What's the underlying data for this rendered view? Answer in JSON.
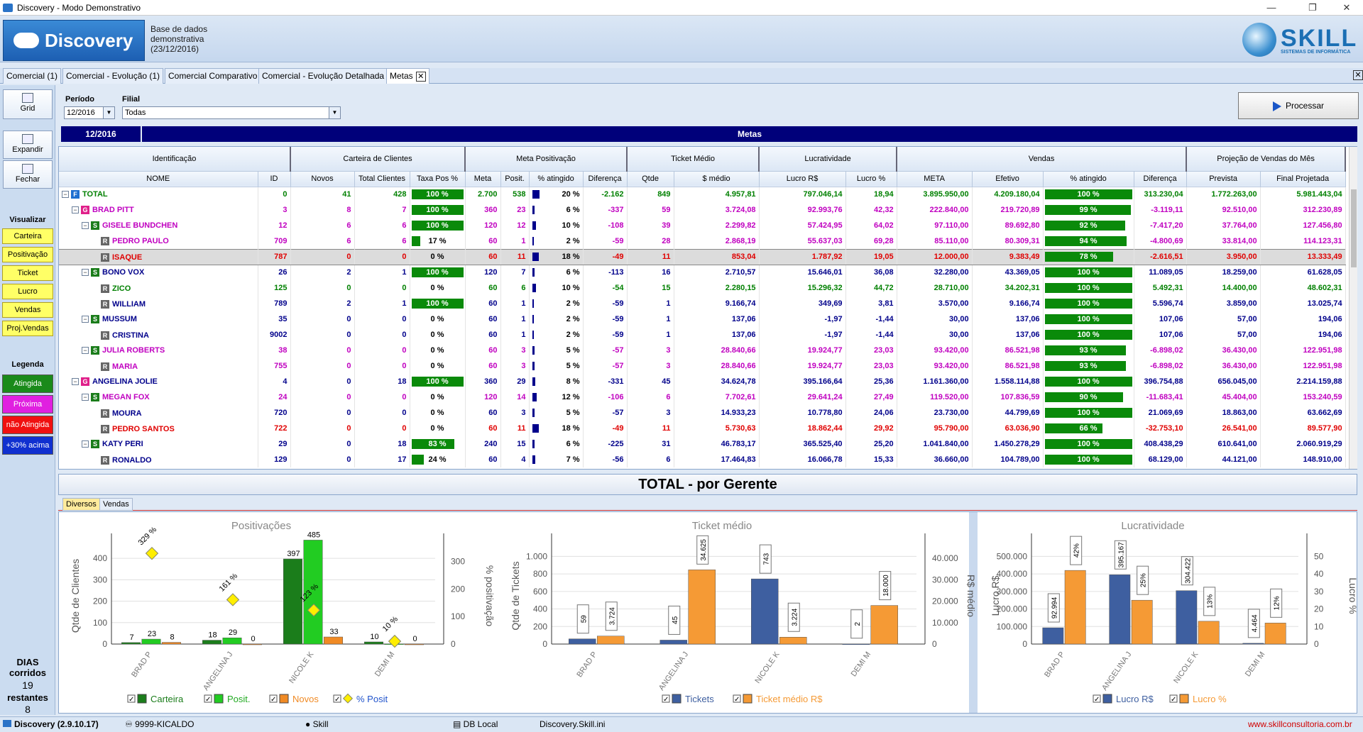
{
  "window": {
    "title": "Discovery - Modo Demonstrativo"
  },
  "header": {
    "logo": "Discovery",
    "db_line1": "Base de dados",
    "db_line2": "demonstrativa",
    "db_line3": "(23/12/2016)",
    "brand": "SKILL",
    "brand_sub": "SISTEMAS DE INFORMÁTICA"
  },
  "tabs": [
    "Comercial (1)",
    "Comercial - Evolução (1)",
    "Comercial Comparativo",
    "Comercial - Evolução Detalhada",
    "Metas"
  ],
  "sidebar": {
    "grid": "Grid",
    "expandir": "Expandir",
    "fechar": "Fechar",
    "visualizar": "Visualizar",
    "views": [
      "Carteira",
      "Positivação",
      "Ticket",
      "Lucro",
      "Vendas",
      "Proj.Vendas"
    ],
    "legenda": "Legenda",
    "legend": [
      {
        "label": "Atingida",
        "color": "#1a8a1a"
      },
      {
        "label": "Próxima",
        "color": "#e020e0"
      },
      {
        "label": "não Atingida",
        "color": "#f01010"
      },
      {
        "label": "+30% acima",
        "color": "#1030d0"
      }
    ],
    "dias_corridos": "DIAS corridos",
    "dias_corridos_val": "19",
    "restantes": "restantes",
    "restantes_val": "8"
  },
  "filters": {
    "periodo_label": "Período",
    "periodo": "12/2016",
    "filial_label": "Filial",
    "filial": "Todas",
    "processar": "Processar"
  },
  "band": {
    "period": "12/2016",
    "title": "Metas"
  },
  "grid": {
    "groups": [
      "Identificação",
      "Carteira de Clientes",
      "Meta Positivação",
      "Ticket Médio",
      "Lucratividade",
      "Vendas",
      "Projeção de Vendas do Mês"
    ],
    "columns": [
      "NOME",
      "ID",
      "Novos",
      "Total Clientes",
      "Taxa Pos %",
      "Meta",
      "Posit.",
      "% atingido",
      "Diferença",
      "Qtde",
      "$ médio",
      "Lucro R$",
      "Lucro %",
      "META",
      "Efetivo",
      "% atingido",
      "Diferença",
      "Prevista",
      "Final Projetada"
    ],
    "rows": [
      {
        "lvl": "F",
        "ind": 0,
        "exp": true,
        "name": "TOTAL",
        "col": "green",
        "id": "0",
        "novos": "41",
        "tc": "428",
        "taxa": "100 %",
        "tp": 100,
        "meta": "2.700",
        "posit": "538",
        "pct": "20 %",
        "pp": 20,
        "dif": "-2.162",
        "qtde": "849",
        "med": "4.957,81",
        "lr": "797.046,14",
        "lp": "18,94",
        "vm": "3.895.950,00",
        "ef": "4.209.180,04",
        "va": "100 %",
        "vp": 100,
        "vd": "313.230,04",
        "prev": "1.772.263,00",
        "fin": "5.981.443,04"
      },
      {
        "lvl": "G",
        "ind": 1,
        "exp": true,
        "name": "BRAD PITT",
        "col": "mag",
        "id": "3",
        "novos": "8",
        "tc": "7",
        "taxa": "100 %",
        "tp": 100,
        "meta": "360",
        "posit": "23",
        "pct": "6 %",
        "pp": 6,
        "dif": "-337",
        "qtde": "59",
        "med": "3.724,08",
        "lr": "92.993,76",
        "lp": "42,32",
        "vm": "222.840,00",
        "ef": "219.720,89",
        "va": "99 %",
        "vp": 99,
        "vd": "-3.119,11",
        "prev": "92.510,00",
        "fin": "312.230,89"
      },
      {
        "lvl": "S",
        "ind": 2,
        "exp": true,
        "name": "GISELE BUNDCHEN",
        "col": "mag",
        "id": "12",
        "novos": "6",
        "tc": "6",
        "taxa": "100 %",
        "tp": 100,
        "meta": "120",
        "posit": "12",
        "pct": "10 %",
        "pp": 10,
        "dif": "-108",
        "qtde": "39",
        "med": "2.299,82",
        "lr": "57.424,95",
        "lp": "64,02",
        "vm": "97.110,00",
        "ef": "89.692,80",
        "va": "92 %",
        "vp": 92,
        "vd": "-7.417,20",
        "prev": "37.764,00",
        "fin": "127.456,80"
      },
      {
        "lvl": "R",
        "ind": 3,
        "exp": false,
        "name": "PEDRO PAULO",
        "col": "mag",
        "id": "709",
        "novos": "6",
        "tc": "6",
        "taxa": "17 %",
        "tp": 17,
        "meta": "60",
        "posit": "1",
        "pct": "2 %",
        "pp": 2,
        "dif": "-59",
        "qtde": "28",
        "med": "2.868,19",
        "lr": "55.637,03",
        "lp": "69,28",
        "vm": "85.110,00",
        "ef": "80.309,31",
        "va": "94 %",
        "vp": 94,
        "vd": "-4.800,69",
        "prev": "33.814,00",
        "fin": "114.123,31"
      },
      {
        "lvl": "R",
        "ind": 3,
        "exp": false,
        "name": "ISAQUE",
        "col": "red",
        "hl": true,
        "id": "787",
        "novos": "0",
        "tc": "0",
        "taxa": "0 %",
        "tp": 0,
        "meta": "60",
        "posit": "11",
        "pct": "18 %",
        "pp": 18,
        "dif": "-49",
        "qtde": "11",
        "med": "853,04",
        "lr": "1.787,92",
        "lp": "19,05",
        "vm": "12.000,00",
        "ef": "9.383,49",
        "va": "78 %",
        "vp": 78,
        "vd": "-2.616,51",
        "prev": "3.950,00",
        "fin": "13.333,49"
      },
      {
        "lvl": "S",
        "ind": 2,
        "exp": true,
        "name": "BONO VOX",
        "col": "blue",
        "id": "26",
        "novos": "2",
        "tc": "1",
        "taxa": "100 %",
        "tp": 100,
        "meta": "120",
        "posit": "7",
        "pct": "6 %",
        "pp": 6,
        "dif": "-113",
        "qtde": "16",
        "med": "2.710,57",
        "lr": "15.646,01",
        "lp": "36,08",
        "vm": "32.280,00",
        "ef": "43.369,05",
        "va": "100 %",
        "vp": 100,
        "vd": "11.089,05",
        "prev": "18.259,00",
        "fin": "61.628,05"
      },
      {
        "lvl": "R",
        "ind": 3,
        "exp": false,
        "name": "ZICO",
        "col": "green",
        "id": "125",
        "novos": "0",
        "tc": "0",
        "taxa": "0 %",
        "tp": 0,
        "meta": "60",
        "posit": "6",
        "pct": "10 %",
        "pp": 10,
        "dif": "-54",
        "qtde": "15",
        "med": "2.280,15",
        "lr": "15.296,32",
        "lp": "44,72",
        "vm": "28.710,00",
        "ef": "34.202,31",
        "va": "100 %",
        "vp": 100,
        "vd": "5.492,31",
        "prev": "14.400,00",
        "fin": "48.602,31"
      },
      {
        "lvl": "R",
        "ind": 3,
        "exp": false,
        "name": "WILLIAM",
        "col": "blue",
        "id": "789",
        "novos": "2",
        "tc": "1",
        "taxa": "100 %",
        "tp": 100,
        "meta": "60",
        "posit": "1",
        "pct": "2 %",
        "pp": 2,
        "dif": "-59",
        "qtde": "1",
        "med": "9.166,74",
        "lr": "349,69",
        "lp": "3,81",
        "vm": "3.570,00",
        "ef": "9.166,74",
        "va": "100 %",
        "vp": 100,
        "vd": "5.596,74",
        "prev": "3.859,00",
        "fin": "13.025,74"
      },
      {
        "lvl": "S",
        "ind": 2,
        "exp": true,
        "name": "MUSSUM",
        "col": "blue",
        "id": "35",
        "novos": "0",
        "tc": "0",
        "taxa": "0 %",
        "tp": 0,
        "meta": "60",
        "posit": "1",
        "pct": "2 %",
        "pp": 2,
        "dif": "-59",
        "qtde": "1",
        "med": "137,06",
        "lr": "-1,97",
        "lp": "-1,44",
        "vm": "30,00",
        "ef": "137,06",
        "va": "100 %",
        "vp": 100,
        "vd": "107,06",
        "prev": "57,00",
        "fin": "194,06"
      },
      {
        "lvl": "R",
        "ind": 3,
        "exp": false,
        "name": "CRISTINA",
        "col": "blue",
        "id": "9002",
        "novos": "0",
        "tc": "0",
        "taxa": "0 %",
        "tp": 0,
        "meta": "60",
        "posit": "1",
        "pct": "2 %",
        "pp": 2,
        "dif": "-59",
        "qtde": "1",
        "med": "137,06",
        "lr": "-1,97",
        "lp": "-1,44",
        "vm": "30,00",
        "ef": "137,06",
        "va": "100 %",
        "vp": 100,
        "vd": "107,06",
        "prev": "57,00",
        "fin": "194,06"
      },
      {
        "lvl": "S",
        "ind": 2,
        "exp": true,
        "name": "JULIA ROBERTS",
        "col": "mag",
        "id": "38",
        "novos": "0",
        "tc": "0",
        "taxa": "0 %",
        "tp": 0,
        "meta": "60",
        "posit": "3",
        "pct": "5 %",
        "pp": 5,
        "dif": "-57",
        "qtde": "3",
        "med": "28.840,66",
        "lr": "19.924,77",
        "lp": "23,03",
        "vm": "93.420,00",
        "ef": "86.521,98",
        "va": "93 %",
        "vp": 93,
        "vd": "-6.898,02",
        "prev": "36.430,00",
        "fin": "122.951,98"
      },
      {
        "lvl": "R",
        "ind": 3,
        "exp": false,
        "name": "MARIA",
        "col": "mag",
        "id": "755",
        "novos": "0",
        "tc": "0",
        "taxa": "0 %",
        "tp": 0,
        "meta": "60",
        "posit": "3",
        "pct": "5 %",
        "pp": 5,
        "dif": "-57",
        "qtde": "3",
        "med": "28.840,66",
        "lr": "19.924,77",
        "lp": "23,03",
        "vm": "93.420,00",
        "ef": "86.521,98",
        "va": "93 %",
        "vp": 93,
        "vd": "-6.898,02",
        "prev": "36.430,00",
        "fin": "122.951,98"
      },
      {
        "lvl": "G",
        "ind": 1,
        "exp": true,
        "name": "ANGELINA JOLIE",
        "col": "blue",
        "id": "4",
        "novos": "0",
        "tc": "18",
        "taxa": "100 %",
        "tp": 100,
        "meta": "360",
        "posit": "29",
        "pct": "8 %",
        "pp": 8,
        "dif": "-331",
        "qtde": "45",
        "med": "34.624,78",
        "lr": "395.166,64",
        "lp": "25,36",
        "vm": "1.161.360,00",
        "ef": "1.558.114,88",
        "va": "100 %",
        "vp": 100,
        "vd": "396.754,88",
        "prev": "656.045,00",
        "fin": "2.214.159,88"
      },
      {
        "lvl": "S",
        "ind": 2,
        "exp": true,
        "name": "MEGAN FOX",
        "col": "mag",
        "id": "24",
        "novos": "0",
        "tc": "0",
        "taxa": "0 %",
        "tp": 0,
        "meta": "120",
        "posit": "14",
        "pct": "12 %",
        "pp": 12,
        "dif": "-106",
        "qtde": "6",
        "med": "7.702,61",
        "lr": "29.641,24",
        "lp": "27,49",
        "vm": "119.520,00",
        "ef": "107.836,59",
        "va": "90 %",
        "vp": 90,
        "vd": "-11.683,41",
        "prev": "45.404,00",
        "fin": "153.240,59"
      },
      {
        "lvl": "R",
        "ind": 3,
        "exp": false,
        "name": "MOURA",
        "col": "blue",
        "id": "720",
        "novos": "0",
        "tc": "0",
        "taxa": "0 %",
        "tp": 0,
        "meta": "60",
        "posit": "3",
        "pct": "5 %",
        "pp": 5,
        "dif": "-57",
        "qtde": "3",
        "med": "14.933,23",
        "lr": "10.778,80",
        "lp": "24,06",
        "vm": "23.730,00",
        "ef": "44.799,69",
        "va": "100 %",
        "vp": 100,
        "vd": "21.069,69",
        "prev": "18.863,00",
        "fin": "63.662,69"
      },
      {
        "lvl": "R",
        "ind": 3,
        "exp": false,
        "name": "PEDRO SANTOS",
        "col": "red",
        "id": "722",
        "novos": "0",
        "tc": "0",
        "taxa": "0 %",
        "tp": 0,
        "meta": "60",
        "posit": "11",
        "pct": "18 %",
        "pp": 18,
        "dif": "-49",
        "qtde": "11",
        "med": "5.730,63",
        "lr": "18.862,44",
        "lp": "29,92",
        "vm": "95.790,00",
        "ef": "63.036,90",
        "va": "66 %",
        "vp": 66,
        "vd": "-32.753,10",
        "prev": "26.541,00",
        "fin": "89.577,90"
      },
      {
        "lvl": "S",
        "ind": 2,
        "exp": true,
        "name": "KATY PERI",
        "col": "blue",
        "id": "29",
        "novos": "0",
        "tc": "18",
        "taxa": "83 %",
        "tp": 83,
        "meta": "240",
        "posit": "15",
        "pct": "6 %",
        "pp": 6,
        "dif": "-225",
        "qtde": "31",
        "med": "46.783,17",
        "lr": "365.525,40",
        "lp": "25,20",
        "vm": "1.041.840,00",
        "ef": "1.450.278,29",
        "va": "100 %",
        "vp": 100,
        "vd": "408.438,29",
        "prev": "610.641,00",
        "fin": "2.060.919,29"
      },
      {
        "lvl": "R",
        "ind": 3,
        "exp": false,
        "name": "RONALDO",
        "col": "blue",
        "id": "129",
        "novos": "0",
        "tc": "17",
        "taxa": "24 %",
        "tp": 24,
        "meta": "60",
        "posit": "4",
        "pct": "7 %",
        "pp": 7,
        "dif": "-56",
        "qtde": "6",
        "med": "17.464,83",
        "lr": "16.066,78",
        "lp": "15,33",
        "vm": "36.660,00",
        "ef": "104.789,00",
        "va": "100 %",
        "vp": 100,
        "vd": "68.129,00",
        "prev": "44.121,00",
        "fin": "148.910,00"
      }
    ]
  },
  "bottom": {
    "title": "TOTAL - por Gerente",
    "tabs": [
      "Diversos",
      "Vendas"
    ]
  },
  "chart_data": [
    {
      "type": "bar",
      "title": "Positivações",
      "categories": [
        "BRAD P",
        "ANGELINA J",
        "NICOLE K",
        "DEMI M"
      ],
      "ylabel": "Qtde de Clientes",
      "y2label": "% positivação",
      "ylim": [
        0,
        450
      ],
      "y2lim": [
        0,
        350
      ],
      "yticks": [
        "0",
        "100",
        "200",
        "300",
        "400"
      ],
      "y2ticks": [
        "0",
        "100",
        "200",
        "300"
      ],
      "series": [
        {
          "name": "Carteira",
          "color": "#1b7d1b",
          "values": [
            7,
            18,
            397,
            10
          ],
          "labels": [
            "7",
            "18",
            "397",
            "10"
          ]
        },
        {
          "name": "Posit.",
          "color": "#22cc22",
          "values": [
            23,
            29,
            485,
            1
          ],
          "labels": [
            "23",
            "29",
            "485",
            "1"
          ]
        },
        {
          "name": "Novos",
          "color": "#f08a24",
          "values": [
            8,
            0,
            33,
            0
          ],
          "labels": [
            "8",
            "0",
            "33",
            "0"
          ]
        },
        {
          "name": "% Posit",
          "color": "#ffee00",
          "values": [
            329,
            161,
            123,
            10
          ],
          "labels": [
            "329 %",
            "161 %",
            "123 %",
            "10 %"
          ],
          "axis": "right"
        }
      ]
    },
    {
      "type": "bar",
      "title": "Ticket médio",
      "categories": [
        "BRAD P",
        "ANGELINA J",
        "NICOLE K",
        "DEMI M"
      ],
      "ylabel": "Qtde de Tickets",
      "y2label": "R$ médio",
      "ylim": [
        0,
        1100
      ],
      "y2lim": [
        0,
        45000
      ],
      "yticks": [
        "0",
        "200",
        "400",
        "600",
        "800",
        "1.000"
      ],
      "y2ticks": [
        "0",
        "10.000",
        "20.000",
        "30.000",
        "40.000"
      ],
      "series": [
        {
          "name": "Tickets",
          "color": "#3e5fa0",
          "values": [
            59,
            45,
            743,
            2
          ],
          "labels": [
            "59",
            "45",
            "743",
            "2"
          ]
        },
        {
          "name": "Ticket médio R$",
          "color": "#f59a35",
          "values": [
            3724,
            34625,
            3224,
            18000
          ],
          "labels": [
            "3.724",
            "34.625",
            "3.224",
            "18.000"
          ],
          "axis": "right"
        }
      ]
    },
    {
      "type": "bar",
      "title": "Lucratividade",
      "categories": [
        "BRAD P",
        "ANGELINA J",
        "NICOLE K",
        "DEMI M"
      ],
      "ylabel": "Lucro R$",
      "y2label": "Lucro %",
      "ylim": [
        0,
        550000
      ],
      "y2lim": [
        0,
        55
      ],
      "yticks": [
        "0",
        "100.000",
        "200.000",
        "300.000",
        "400.000",
        "500.000"
      ],
      "y2ticks": [
        "0",
        "10",
        "20",
        "30",
        "40",
        "50"
      ],
      "series": [
        {
          "name": "Lucro R$",
          "color": "#3e5fa0",
          "values": [
            92994,
            395167,
            304422,
            4464
          ],
          "labels": [
            "92.994",
            "395.167",
            "304.422",
            "4.464"
          ]
        },
        {
          "name": "Lucro %",
          "color": "#f59a35",
          "values": [
            42,
            25,
            13,
            12
          ],
          "labels": [
            "42%",
            "25%",
            "13%",
            "12%"
          ],
          "axis": "right"
        }
      ]
    }
  ],
  "status": {
    "app": "Discovery (2.9.10.17)",
    "user_code": "9999-KICALDO",
    "user": "Skill",
    "db": "DB Local",
    "ini": "Discovery.Skill.ini",
    "url": "www.skillconsultoria.com.br"
  }
}
